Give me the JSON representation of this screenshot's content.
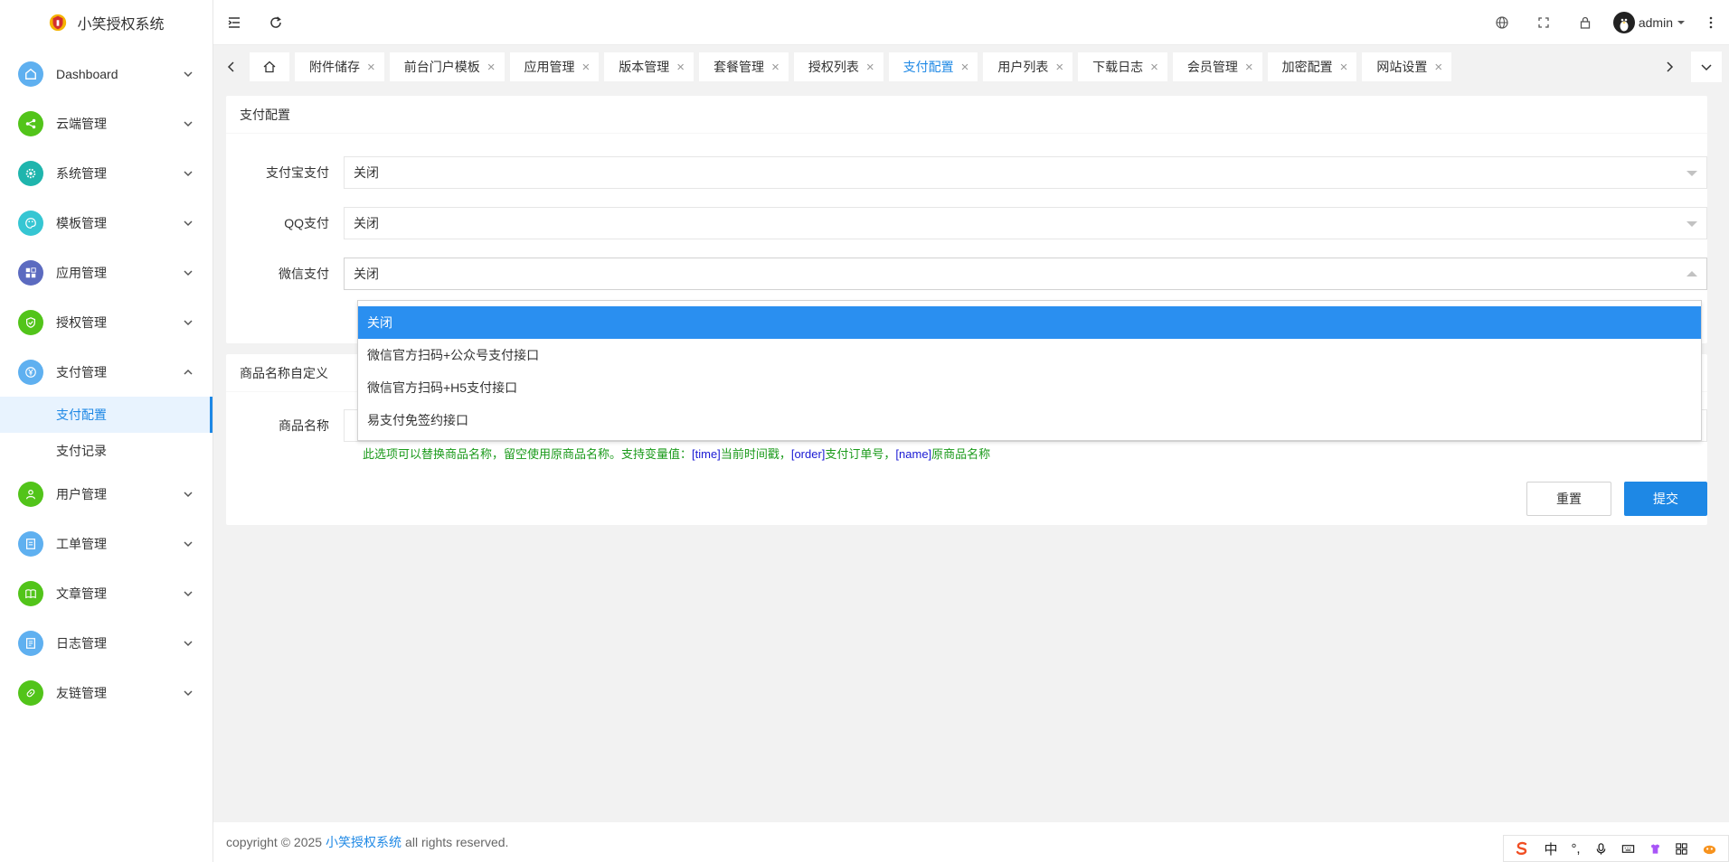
{
  "app": {
    "title": "小笑授权系统"
  },
  "sidebar": {
    "items": [
      {
        "label": "Dashboard",
        "icon": "home-icon",
        "color": "#5fb0f0"
      },
      {
        "label": "云端管理",
        "icon": "share-icon",
        "color": "#52c41a"
      },
      {
        "label": "系统管理",
        "icon": "gear-icon",
        "color": "#1fb5ad"
      },
      {
        "label": "模板管理",
        "icon": "palette-icon",
        "color": "#36c6d3"
      },
      {
        "label": "应用管理",
        "icon": "apps-icon",
        "color": "#5c6bc0"
      },
      {
        "label": "授权管理",
        "icon": "shield-icon",
        "color": "#52c41a"
      },
      {
        "label": "支付管理",
        "icon": "yen-icon",
        "color": "#5fb0f0"
      },
      {
        "label": "用户管理",
        "icon": "user-icon",
        "color": "#52c41a"
      },
      {
        "label": "工单管理",
        "icon": "ticket-icon",
        "color": "#5fb0f0"
      },
      {
        "label": "文章管理",
        "icon": "book-icon",
        "color": "#52c41a"
      },
      {
        "label": "日志管理",
        "icon": "log-icon",
        "color": "#5fb0f0"
      },
      {
        "label": "友链管理",
        "icon": "link-icon",
        "color": "#52c41a"
      }
    ],
    "sub": {
      "config": "支付配置",
      "records": "支付记录"
    }
  },
  "header": {
    "user": "admin"
  },
  "tabs": [
    {
      "label": "附件储存"
    },
    {
      "label": "前台门户模板"
    },
    {
      "label": "应用管理"
    },
    {
      "label": "版本管理"
    },
    {
      "label": "套餐管理"
    },
    {
      "label": "授权列表"
    },
    {
      "label": "支付配置",
      "active": true
    },
    {
      "label": "用户列表"
    },
    {
      "label": "下载日志"
    },
    {
      "label": "会员管理"
    },
    {
      "label": "加密配置"
    },
    {
      "label": "网站设置"
    }
  ],
  "payment_card": {
    "title": "支付配置",
    "alipay": {
      "label": "支付宝支付",
      "value": "关闭"
    },
    "qq": {
      "label": "QQ支付",
      "value": "关闭"
    },
    "wechat": {
      "label": "微信支付",
      "value": "关闭"
    }
  },
  "dropdown": {
    "options": [
      "关闭",
      "微信官方扫码+公众号支付接口",
      "微信官方扫码+H5支付接口",
      "易支付免签约接口"
    ]
  },
  "product_card": {
    "title": "商品名称自定义",
    "label": "商品名称",
    "value": "",
    "help": {
      "t1": "此选项可以替换商品名称，留空使用原商品名称。支持变量值：",
      "v1": "[time]",
      "t2": "当前时间戳，",
      "v2": "[order]",
      "t3": "支付订单号，",
      "v3": "[name]",
      "t4": "原商品名称"
    },
    "reset": "重置",
    "submit": "提交"
  },
  "footer": {
    "prefix": "copyright © 2025",
    "link": "小笑授权系统",
    "suffix": "all rights reserved."
  },
  "ime": {
    "mode": "中",
    "punct": "°,"
  }
}
